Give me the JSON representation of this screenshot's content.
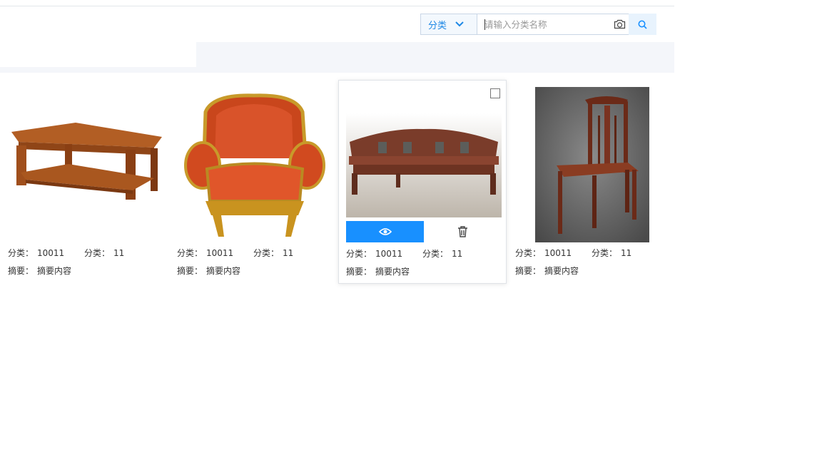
{
  "search": {
    "category_label": "分类",
    "placeholder": "请输入分类名称",
    "value": ""
  },
  "cards": [
    {
      "image": "coffee-table",
      "f1_label": "分类：",
      "f1_value": "10011",
      "f2_label": "分类：",
      "f2_value": "11",
      "sum_label": "摘要：",
      "sum_value": "摘要内容",
      "hovered": false
    },
    {
      "image": "armchair",
      "f1_label": "分类：",
      "f1_value": "10011",
      "f2_label": "分类：",
      "f2_value": "11",
      "sum_label": "摘要：",
      "sum_value": "摘要内容",
      "hovered": false
    },
    {
      "image": "bench",
      "f1_label": "分类：",
      "f1_value": "10011",
      "f2_label": "分类：",
      "f2_value": "11",
      "sum_label": "摘要：",
      "sum_value": "摘要内容",
      "hovered": true
    },
    {
      "image": "chair",
      "f1_label": "分类：",
      "f1_value": "10011",
      "f2_label": "分类：",
      "f2_value": "11",
      "sum_label": "摘要：",
      "sum_value": "摘要内容",
      "hovered": false
    }
  ],
  "colors": {
    "accent": "#1890ff",
    "band": "#f4f6fa"
  },
  "icons": {
    "camera": "camera-icon",
    "search": "search-icon",
    "view": "eye-icon",
    "delete": "trash-icon",
    "dropdown": "chevron-down-icon"
  }
}
